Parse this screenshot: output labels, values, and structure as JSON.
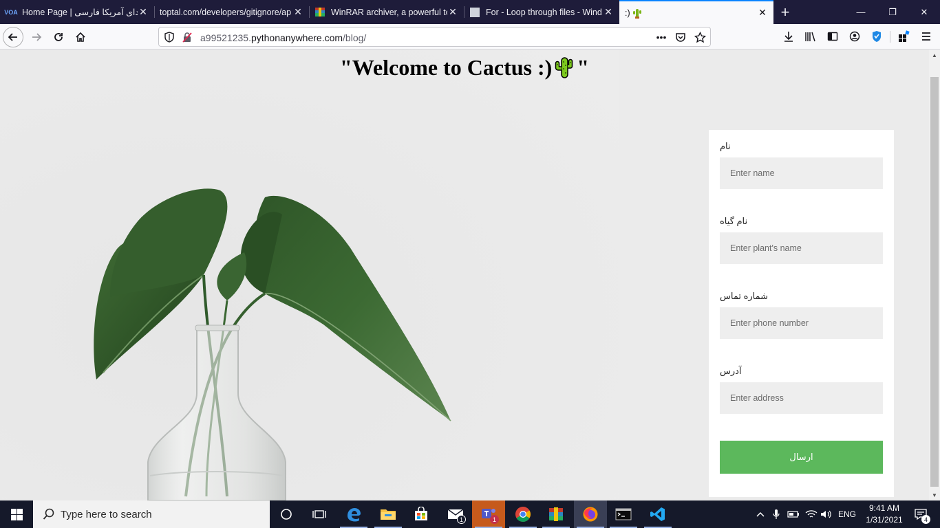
{
  "browser": {
    "tabs": [
      {
        "favicon": "voa-logo-icon",
        "favicon_text": "VOA",
        "title": "Home Page | صدای آمریکا فارسی"
      },
      {
        "favicon": "blank-icon",
        "title": "toptal.com/developers/gitignore/ap"
      },
      {
        "favicon": "winrar-icon",
        "title": "WinRAR archiver, a powerful to"
      },
      {
        "favicon": "generic-page-icon",
        "title": "For - Loop through files - Wind"
      },
      {
        "favicon": "cactus-icon",
        "title": ":)",
        "active": true
      }
    ],
    "new_tab_label": "+",
    "window_controls": {
      "minimize": "—",
      "restore": "❐",
      "close": "✕"
    },
    "address": {
      "prefix": "a99521235.",
      "domain": "pythonanywhere.com",
      "path": "/blog/"
    },
    "page_actions": {
      "more": "•••"
    }
  },
  "page": {
    "heading_before": "\"Welcome to Cactus :)",
    "heading_after": "\"",
    "form": {
      "fields": [
        {
          "label": "نام",
          "placeholder": "Enter name"
        },
        {
          "label": "نام گیاه",
          "placeholder": "Enter plant's name"
        },
        {
          "label": "شماره تماس",
          "placeholder": "Enter phone number"
        },
        {
          "label": "آدرس",
          "placeholder": "Enter address"
        }
      ],
      "submit_label": "ارسال"
    }
  },
  "taskbar": {
    "search_placeholder": "Type here to search",
    "apps": [
      {
        "name": "task-view-icon"
      },
      {
        "name": "timeline-icon"
      },
      {
        "name": "edge-icon"
      },
      {
        "name": "file-explorer-icon"
      },
      {
        "name": "store-icon"
      },
      {
        "name": "mail-icon",
        "badge": "1"
      },
      {
        "name": "teams-icon",
        "badge": "1"
      },
      {
        "name": "chrome-icon"
      },
      {
        "name": "winrar-icon"
      },
      {
        "name": "firefox-icon"
      },
      {
        "name": "terminal-icon"
      },
      {
        "name": "vscode-icon"
      }
    ],
    "language": "ENG",
    "time": "9:41 AM",
    "date": "1/31/2021",
    "notification_count": "4"
  },
  "colors": {
    "tabbar_bg": "#1e1c3a",
    "active_tab_accent": "#0a84ff",
    "submit_bg": "#5cb85c",
    "input_bg": "#eeeeee",
    "page_bg": "#ebebeb"
  }
}
